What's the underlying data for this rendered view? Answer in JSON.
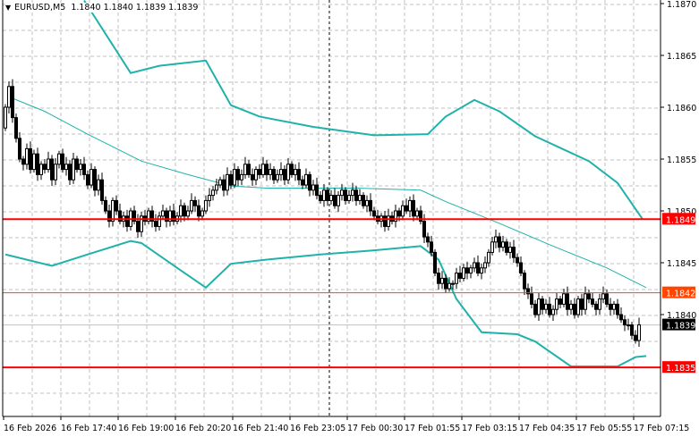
{
  "header": {
    "symbol": "EURUSD,M5",
    "open": "1.1840",
    "high": "1.1840",
    "low": "1.1839",
    "close": "1.1839"
  },
  "chart_data": {
    "type": "candlestick",
    "symbol": "EURUSD",
    "timeframe": "M5",
    "ylim": [
      1.18315,
      1.1871
    ],
    "y_ticks": [
      "1.1870",
      "1.1865",
      "1.1860",
      "1.1855",
      "1.1850",
      "1.1845",
      "1.1840"
    ],
    "x_ticks": [
      "16 Feb 2026",
      "16 Feb 17:40",
      "16 Feb 19:00",
      "16 Feb 20:20",
      "16 Feb 21:40",
      "16 Feb 23:05",
      "17 Feb 00:30",
      "17 Feb 01:55",
      "17 Feb 03:15",
      "17 Feb 04:35",
      "17 Feb 05:55",
      "17 Feb 07:15"
    ],
    "first_open": 1.1858,
    "closes": [
      1.186,
      1.1862,
      1.1859,
      1.1857,
      1.1855,
      1.18545,
      1.1856,
      1.1854,
      1.18555,
      1.18535,
      1.18545,
      1.1854,
      1.1855,
      1.1853,
      1.18545,
      1.18555,
      1.1854,
      1.18545,
      1.1853,
      1.1855,
      1.1854,
      1.18545,
      1.18535,
      1.18525,
      1.1854,
      1.1852,
      1.1853,
      1.1851,
      1.185,
      1.1849,
      1.1851,
      1.185,
      1.1849,
      1.18495,
      1.18485,
      1.185,
      1.1849,
      1.1848,
      1.18495,
      1.1849,
      1.185,
      1.1849,
      1.18485,
      1.18495,
      1.185,
      1.1849,
      1.185,
      1.1849,
      1.18495,
      1.18505,
      1.18495,
      1.185,
      1.1851,
      1.18505,
      1.18495,
      1.185,
      1.1851,
      1.18515,
      1.1852,
      1.18525,
      1.1853,
      1.1852,
      1.18535,
      1.18525,
      1.1854,
      1.1853,
      1.18535,
      1.18545,
      1.18535,
      1.1853,
      1.1854,
      1.18535,
      1.18545,
      1.18535,
      1.1854,
      1.1853,
      1.18535,
      1.1854,
      1.1853,
      1.18545,
      1.18535,
      1.1854,
      1.1853,
      1.18525,
      1.18535,
      1.1852,
      1.18525,
      1.18515,
      1.1851,
      1.1852,
      1.1851,
      1.18515,
      1.18505,
      1.18515,
      1.1852,
      1.1851,
      1.18515,
      1.1852,
      1.1851,
      1.18515,
      1.18505,
      1.1851,
      1.185,
      1.18495,
      1.1849,
      1.18495,
      1.18485,
      1.18495,
      1.1849,
      1.185,
      1.18495,
      1.18505,
      1.185,
      1.1851,
      1.18495,
      1.185,
      1.1849,
      1.18475,
      1.1847,
      1.1846,
      1.1844,
      1.1843,
      1.18435,
      1.18425,
      1.1843,
      1.1843,
      1.1844,
      1.18435,
      1.18445,
      1.1844,
      1.18445,
      1.1845,
      1.1844,
      1.18445,
      1.1845,
      1.1846,
      1.1847,
      1.18475,
      1.18465,
      1.1847,
      1.1846,
      1.18465,
      1.18455,
      1.1845,
      1.1844,
      1.18425,
      1.1842,
      1.1841,
      1.184,
      1.18415,
      1.18405,
      1.1841,
      1.184,
      1.18405,
      1.18415,
      1.1841,
      1.1842,
      1.18405,
      1.1841,
      1.184,
      1.18415,
      1.18405,
      1.1842,
      1.18415,
      1.1841,
      1.18405,
      1.18415,
      1.1842,
      1.1841,
      1.18405,
      1.1841,
      1.184,
      1.18395,
      1.1839,
      1.1839,
      1.1838,
      1.18375,
      1.1839
    ],
    "bollinger_upper": [
      [
        22,
        1.18703
      ],
      [
        35,
        1.18633
      ],
      [
        43,
        1.1864
      ],
      [
        56,
        1.18645
      ],
      [
        63,
        1.18602
      ],
      [
        71,
        1.18591
      ],
      [
        86,
        1.18581
      ],
      [
        103,
        1.18573
      ],
      [
        118,
        1.18574
      ],
      [
        123,
        1.18591
      ],
      [
        131,
        1.18607
      ],
      [
        138,
        1.18596
      ],
      [
        148,
        1.18572
      ],
      [
        163,
        1.18548
      ],
      [
        171,
        1.18527
      ],
      [
        178,
        1.18492
      ]
    ],
    "bollinger_lower": [
      [
        0,
        1.18458
      ],
      [
        13,
        1.18447
      ],
      [
        23,
        1.18458
      ],
      [
        35,
        1.18471
      ],
      [
        38,
        1.18469
      ],
      [
        48,
        1.18445
      ],
      [
        56,
        1.18426
      ],
      [
        63,
        1.18449
      ],
      [
        73,
        1.18453
      ],
      [
        88,
        1.18458
      ],
      [
        103,
        1.18462
      ],
      [
        116,
        1.18466
      ],
      [
        121,
        1.18453
      ],
      [
        126,
        1.18415
      ],
      [
        133,
        1.18383
      ],
      [
        143,
        1.18381
      ],
      [
        148,
        1.18374
      ],
      [
        158,
        1.1835
      ],
      [
        171,
        1.1835
      ],
      [
        176,
        1.18359
      ],
      [
        179,
        1.1836
      ]
    ],
    "moving_average": [
      [
        1,
        1.1861
      ],
      [
        11,
        1.18596
      ],
      [
        23,
        1.18574
      ],
      [
        38,
        1.18548
      ],
      [
        51,
        1.18535
      ],
      [
        63,
        1.18524
      ],
      [
        73,
        1.18522
      ],
      [
        98,
        1.18522
      ],
      [
        116,
        1.1852
      ],
      [
        123,
        1.18509
      ],
      [
        138,
        1.18488
      ],
      [
        153,
        1.18466
      ],
      [
        168,
        1.18445
      ],
      [
        179,
        1.18426
      ]
    ],
    "horizontal_lines": [
      {
        "label": "1.1849",
        "price": 1.18492,
        "color": "#ff0000"
      },
      {
        "label": "1.1842",
        "price": 1.18421,
        "color": "#ff4500"
      },
      {
        "label": "1.1835",
        "price": 1.18349,
        "color": "#ff0000"
      }
    ],
    "current_price": {
      "label": "1.1839",
      "price": 1.1839
    },
    "separator_bar": 90.5,
    "colors": {
      "band": "#20b2aa",
      "grid": "#c0c0c0",
      "candle": "#000000"
    }
  }
}
